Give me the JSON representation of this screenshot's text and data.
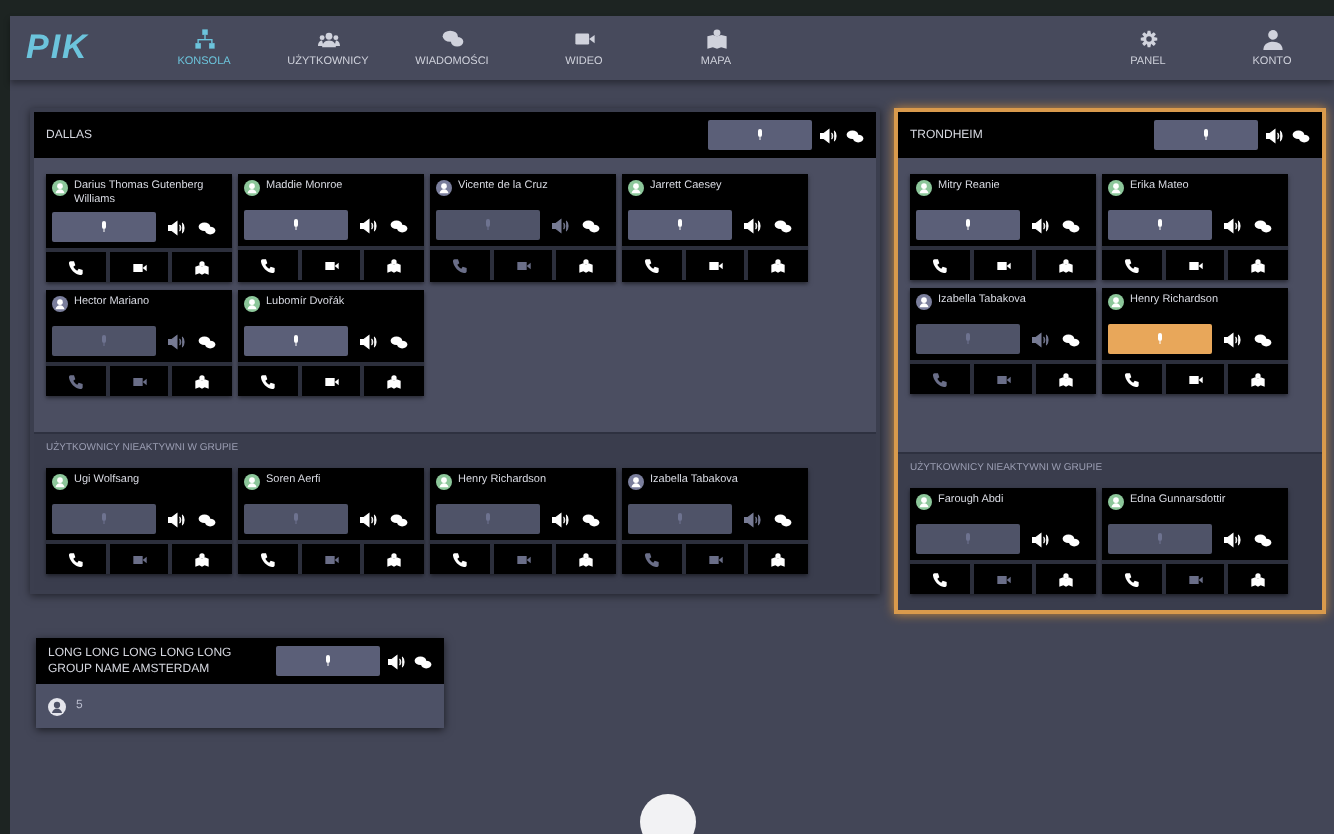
{
  "nav": {
    "logo": "PIK",
    "items": [
      {
        "label": "KONSOLA",
        "selected": true
      },
      {
        "label": "UŻYTKOWNICY",
        "selected": false
      },
      {
        "label": "WIADOMOŚCI",
        "selected": false
      },
      {
        "label": "WIDEO",
        "selected": false
      },
      {
        "label": "MAPA",
        "selected": false
      }
    ],
    "right": [
      {
        "label": "PANEL",
        "selected": false
      },
      {
        "label": "KONTO",
        "selected": false
      }
    ]
  },
  "groups": [
    {
      "name": "DALLAS",
      "highlighted": false,
      "active_users": [
        {
          "name": "Darius Thomas Gutenberg Williams",
          "online": true,
          "mic_enabled": true,
          "talking": false,
          "video": true
        },
        {
          "name": "Maddie Monroe",
          "online": true,
          "mic_enabled": true,
          "talking": false,
          "video": true
        },
        {
          "name": "Vicente de la Cruz",
          "online": false,
          "mic_enabled": false,
          "talking": false,
          "video": false
        },
        {
          "name": "Jarrett Caesey",
          "online": true,
          "mic_enabled": true,
          "talking": false,
          "video": true
        },
        {
          "name": "Hector Mariano",
          "online": false,
          "mic_enabled": false,
          "talking": false,
          "video": false
        },
        {
          "name": "Lubomír Dvořák",
          "online": true,
          "mic_enabled": true,
          "talking": false,
          "video": true
        }
      ],
      "inactive_title": "UŻYTKOWNICY NIEAKTYWNI W GRUPIE",
      "inactive_users": [
        {
          "name": "Ugi Wolfsang",
          "online": true,
          "mic_enabled": false,
          "talking": false,
          "video": false
        },
        {
          "name": "Soren Aerfi",
          "online": true,
          "mic_enabled": false,
          "talking": false,
          "video": false
        },
        {
          "name": "Henry Richardson",
          "online": true,
          "mic_enabled": false,
          "talking": false,
          "video": false
        },
        {
          "name": "Izabella Tabakova",
          "online": false,
          "mic_enabled": false,
          "talking": false,
          "video": false
        }
      ]
    },
    {
      "name": "TRONDHEIM",
      "highlighted": true,
      "active_users": [
        {
          "name": "Mitry Reanie",
          "online": true,
          "mic_enabled": true,
          "talking": false,
          "video": true
        },
        {
          "name": "Erika Mateo",
          "online": true,
          "mic_enabled": true,
          "talking": false,
          "video": true
        },
        {
          "name": "Izabella Tabakova",
          "online": false,
          "mic_enabled": false,
          "talking": false,
          "video": false
        },
        {
          "name": "Henry Richardson",
          "online": true,
          "mic_enabled": true,
          "talking": true,
          "video": true
        }
      ],
      "inactive_title": "UŻYTKOWNICY NIEAKTYWNI W GRUPIE",
      "inactive_users": [
        {
          "name": "Farough Abdi",
          "online": true,
          "mic_enabled": false,
          "talking": false,
          "video": false
        },
        {
          "name": "Edna Gunnarsdottir",
          "online": true,
          "mic_enabled": false,
          "talking": false,
          "video": false
        }
      ]
    }
  ],
  "collapsed_group": {
    "name": "LONG LONG LONG LONG LONG GROUP NAME AMSTERDAM",
    "count": "5"
  }
}
